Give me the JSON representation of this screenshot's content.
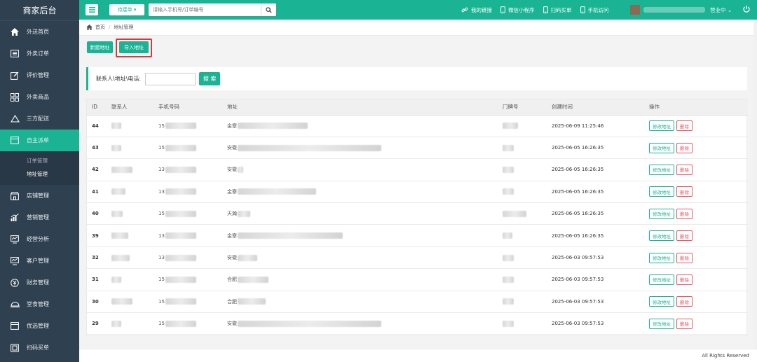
{
  "brand": "商家后台",
  "sidebar": {
    "items": [
      {
        "label": "外送首页",
        "icon": "home-icon"
      },
      {
        "label": "外卖订单",
        "icon": "list-icon"
      },
      {
        "label": "评价管理",
        "icon": "edit-icon"
      },
      {
        "label": "外卖商品",
        "icon": "grid-icon"
      },
      {
        "label": "三方配送",
        "icon": "cloud-icon"
      },
      {
        "label": "自主派单",
        "icon": "window-icon",
        "active": true
      },
      {
        "label": "店铺管理",
        "icon": "store-icon"
      },
      {
        "label": "营销管理",
        "icon": "chart-icon"
      },
      {
        "label": "经营分析",
        "icon": "monitor-icon"
      },
      {
        "label": "客户管理",
        "icon": "monitor-icon"
      },
      {
        "label": "财务管理",
        "icon": "money-icon"
      },
      {
        "label": "堂食管理",
        "icon": "dining-icon"
      },
      {
        "label": "优选管理",
        "icon": "window-icon"
      },
      {
        "label": "扫码买单",
        "icon": "scan-icon"
      }
    ],
    "submenu": [
      {
        "label": "订单管理"
      },
      {
        "label": "地址管理",
        "active": true
      }
    ]
  },
  "topbar": {
    "order_select": "待接单 ▾",
    "search_placeholder": "请输入手机号/订单编号",
    "links": [
      "我的链接",
      "微信小程序",
      "扫码买单",
      "手机访问"
    ],
    "status": "营业中 ⌄"
  },
  "breadcrumb": {
    "home": "首页",
    "current": "地址管理"
  },
  "actions": {
    "new": "新建地址",
    "import": "导入地址"
  },
  "filter": {
    "label": "联系人\\地址\\电话:",
    "button": "搜 索"
  },
  "table": {
    "headers": [
      "ID",
      "联系人",
      "手机号码",
      "地址",
      "门牌号",
      "创建时间",
      "操作"
    ],
    "edit_label": "修改地址",
    "delete_label": "删除",
    "rows": [
      {
        "id": "44",
        "phone_prefix": "15",
        "addr_prefix": "金寨",
        "created": "2025-06-09 11:25:46"
      },
      {
        "id": "43",
        "phone_prefix": "15",
        "addr_prefix": "安徽",
        "created": "2025-06-05 16:26:35"
      },
      {
        "id": "42",
        "phone_prefix": "13",
        "addr_prefix": "安徽",
        "created": "2025-06-05 16:26:35"
      },
      {
        "id": "41",
        "phone_prefix": "13",
        "addr_prefix": "金寨",
        "created": "2025-06-05 16:26:35"
      },
      {
        "id": "40",
        "phone_prefix": "15",
        "addr_prefix": "天瀚",
        "created": "2025-06-05 16:26:35"
      },
      {
        "id": "39",
        "phone_prefix": "13",
        "addr_prefix": "金寨",
        "created": "2025-06-05 16:26:35"
      },
      {
        "id": "32",
        "phone_prefix": "13",
        "addr_prefix": "安徽",
        "created": "2025-06-03 09:57:53"
      },
      {
        "id": "31",
        "phone_prefix": "15",
        "addr_prefix": "合肥",
        "created": "2025-06-03 09:57:53"
      },
      {
        "id": "30",
        "phone_prefix": "15",
        "addr_prefix": "合肥",
        "created": "2025-06-03 09:57:53"
      },
      {
        "id": "29",
        "phone_prefix": "15",
        "addr_prefix": "安徽",
        "created": "2025-06-03 09:57:53"
      }
    ]
  },
  "footer": "All Rights Reserved",
  "colors": {
    "accent": "#1ab394",
    "sidebar": "#2f4050",
    "danger": "#ed5565",
    "highlight": "#d9363e"
  }
}
